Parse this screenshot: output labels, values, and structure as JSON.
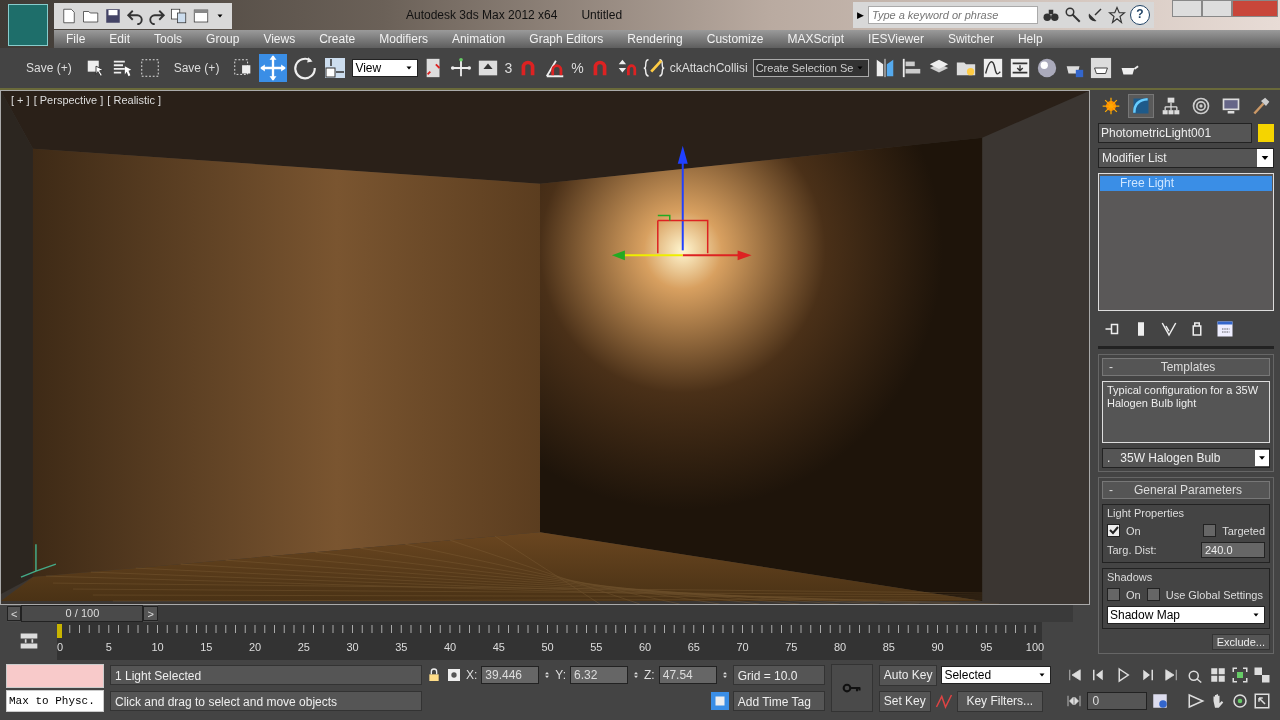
{
  "title_bar": {
    "app_title": "Autodesk 3ds Max  2012 x64",
    "document": "Untitled",
    "search": {
      "placeholder": "Type a keyword or phrase"
    },
    "search_arrow": "▶",
    "help": "?"
  },
  "menu": [
    "File",
    "Edit",
    "Tools",
    "Group",
    "Views",
    "Create",
    "Modifiers",
    "Animation",
    "Graph Editors",
    "Rendering",
    "Customize",
    "MAXScript",
    "IESViewer",
    "Switcher",
    "Help"
  ],
  "toolbar": {
    "save_buttons": [
      "Save (+)",
      "Save (+)"
    ],
    "reference_dropdown": "View",
    "snap_label": "3",
    "percent_label": "%",
    "script_label": "ckAttachCollisi",
    "selection_set": "Create Selection Se"
  },
  "viewport": {
    "labels": [
      "[ + ]",
      "[ Perspective ]",
      "[ Realistic ]"
    ]
  },
  "command_panel": {
    "tabs": [
      {
        "selected": false
      },
      {
        "selected": true
      },
      {
        "selected": false
      },
      {
        "selected": false
      },
      {
        "selected": false
      },
      {
        "selected": false
      }
    ],
    "object_name": "PhotometricLight001",
    "modifier_list": "Modifier List",
    "modifier_stack": [
      {
        "label": "Free Light",
        "selected": true
      }
    ],
    "templates": {
      "toggle": "-",
      "title": "Templates",
      "description": "Typical configuration for a 35W Halogen Bulb light",
      "preset_marker": ".",
      "preset": "35W Halogen Bulb"
    },
    "general_parameters": {
      "toggle": "-",
      "title": "General Parameters",
      "light_properties": {
        "title": "Light Properties",
        "on": {
          "label": "On",
          "checked": true
        },
        "targeted": {
          "label": "Targeted",
          "checked": false
        },
        "targ_dist": {
          "label": "Targ. Dist:",
          "value": "240.0"
        }
      },
      "shadows": {
        "title": "Shadows",
        "on": {
          "label": "On",
          "checked": false
        },
        "use_global": {
          "label": "Use Global Settings",
          "checked": false
        },
        "type": "Shadow Map",
        "exclude": "Exclude..."
      }
    }
  },
  "timeline": {
    "prev": "<",
    "frame": "0 / 100",
    "slider": {
      "level": 0
    },
    "next": ">",
    "ticks": [
      "0",
      "5",
      "10",
      "15",
      "20",
      "25",
      "30",
      "35",
      "40",
      "45",
      "50",
      "55",
      "60",
      "65",
      "70",
      "75",
      "80",
      "85",
      "90",
      "95",
      "100"
    ]
  },
  "status": {
    "listener": "Max to Physc.",
    "selection": "1 Light Selected",
    "prompt": "Click and drag to select and move objects",
    "coords": [
      {
        "label": "X:",
        "value": "39.446"
      },
      {
        "label": "Y:",
        "value": "6.32"
      },
      {
        "label": "Z:",
        "value": "47.54"
      }
    ],
    "grid": "Grid = 10.0",
    "time_tag": "Add Time Tag",
    "auto_key": "Auto Key",
    "set_key": "Set Key",
    "key_mode": "Selected",
    "key_filters": "Key Filters...",
    "current_frame": "0"
  }
}
